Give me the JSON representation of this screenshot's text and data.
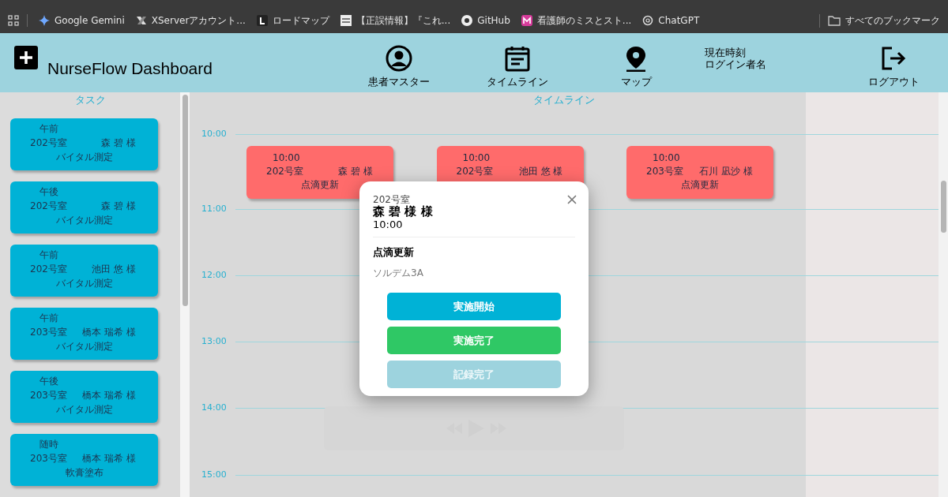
{
  "bookmarks": [
    {
      "label": "Google Gemini",
      "kind": "gemini"
    },
    {
      "label": "XServerアカウント...",
      "kind": "xserver"
    },
    {
      "label": "ロードマップ",
      "kind": "letter"
    },
    {
      "label": "【正誤情報】『これ...",
      "kind": "doc"
    },
    {
      "label": "GitHub",
      "kind": "github"
    },
    {
      "label": "看護師のミスとスト...",
      "kind": "m"
    },
    {
      "label": "ChatGPT",
      "kind": "gpt"
    }
  ],
  "all_bookmarks": "すべてのブックマーク",
  "header": {
    "title": "NurseFlow Dashboard",
    "nav": [
      {
        "label": "患者マスター",
        "kind": "person"
      },
      {
        "label": "タイムライン",
        "kind": "calendar"
      },
      {
        "label": "マップ",
        "kind": "pin"
      }
    ],
    "info": [
      "現在時刻",
      "ログイン者名"
    ],
    "logout": "ログアウト"
  },
  "tasks": {
    "title": "タスク",
    "items": [
      {
        "period": "午前",
        "room": "202号室",
        "patient": "森 碧 様",
        "task": "バイタル測定"
      },
      {
        "period": "午後",
        "room": "202号室",
        "patient": "森 碧 様",
        "task": "バイタル測定"
      },
      {
        "period": "午前",
        "room": "202号室",
        "patient": "池田 悠 様",
        "task": "バイタル測定"
      },
      {
        "period": "午前",
        "room": "203号室",
        "patient": "橋本 瑞希 様",
        "task": "バイタル測定"
      },
      {
        "period": "午後",
        "room": "203号室",
        "patient": "橋本 瑞希 様",
        "task": "バイタル測定"
      },
      {
        "period": "随時",
        "room": "203号室",
        "patient": "橋本 瑞希 様",
        "task": "軟膏塗布"
      }
    ]
  },
  "timeline": {
    "title": "タイムライン",
    "hours": [
      "10:00",
      "11:00",
      "12:00",
      "13:00",
      "14:00",
      "15:00"
    ],
    "events": [
      {
        "time": "10:00",
        "room": "202号室",
        "patient": "森 碧 様",
        "task": "点滴更新"
      },
      {
        "time": "10:00",
        "room": "202号室",
        "patient": "池田 悠 様"
      },
      {
        "time": "10:00",
        "room": "203号室",
        "patient": "石川 凪沙 様",
        "task": "点滴更新"
      }
    ]
  },
  "modal": {
    "room": "202号室",
    "patient": "森 碧 様 様",
    "time": "10:00",
    "task": "点滴更新",
    "note": "ソルデム3A",
    "buttons": [
      {
        "label": "実施開始",
        "kind": "start",
        "disabled": false
      },
      {
        "label": "実施完了",
        "kind": "done",
        "disabled": false
      },
      {
        "label": "記録完了",
        "kind": "record",
        "disabled": true
      }
    ]
  }
}
